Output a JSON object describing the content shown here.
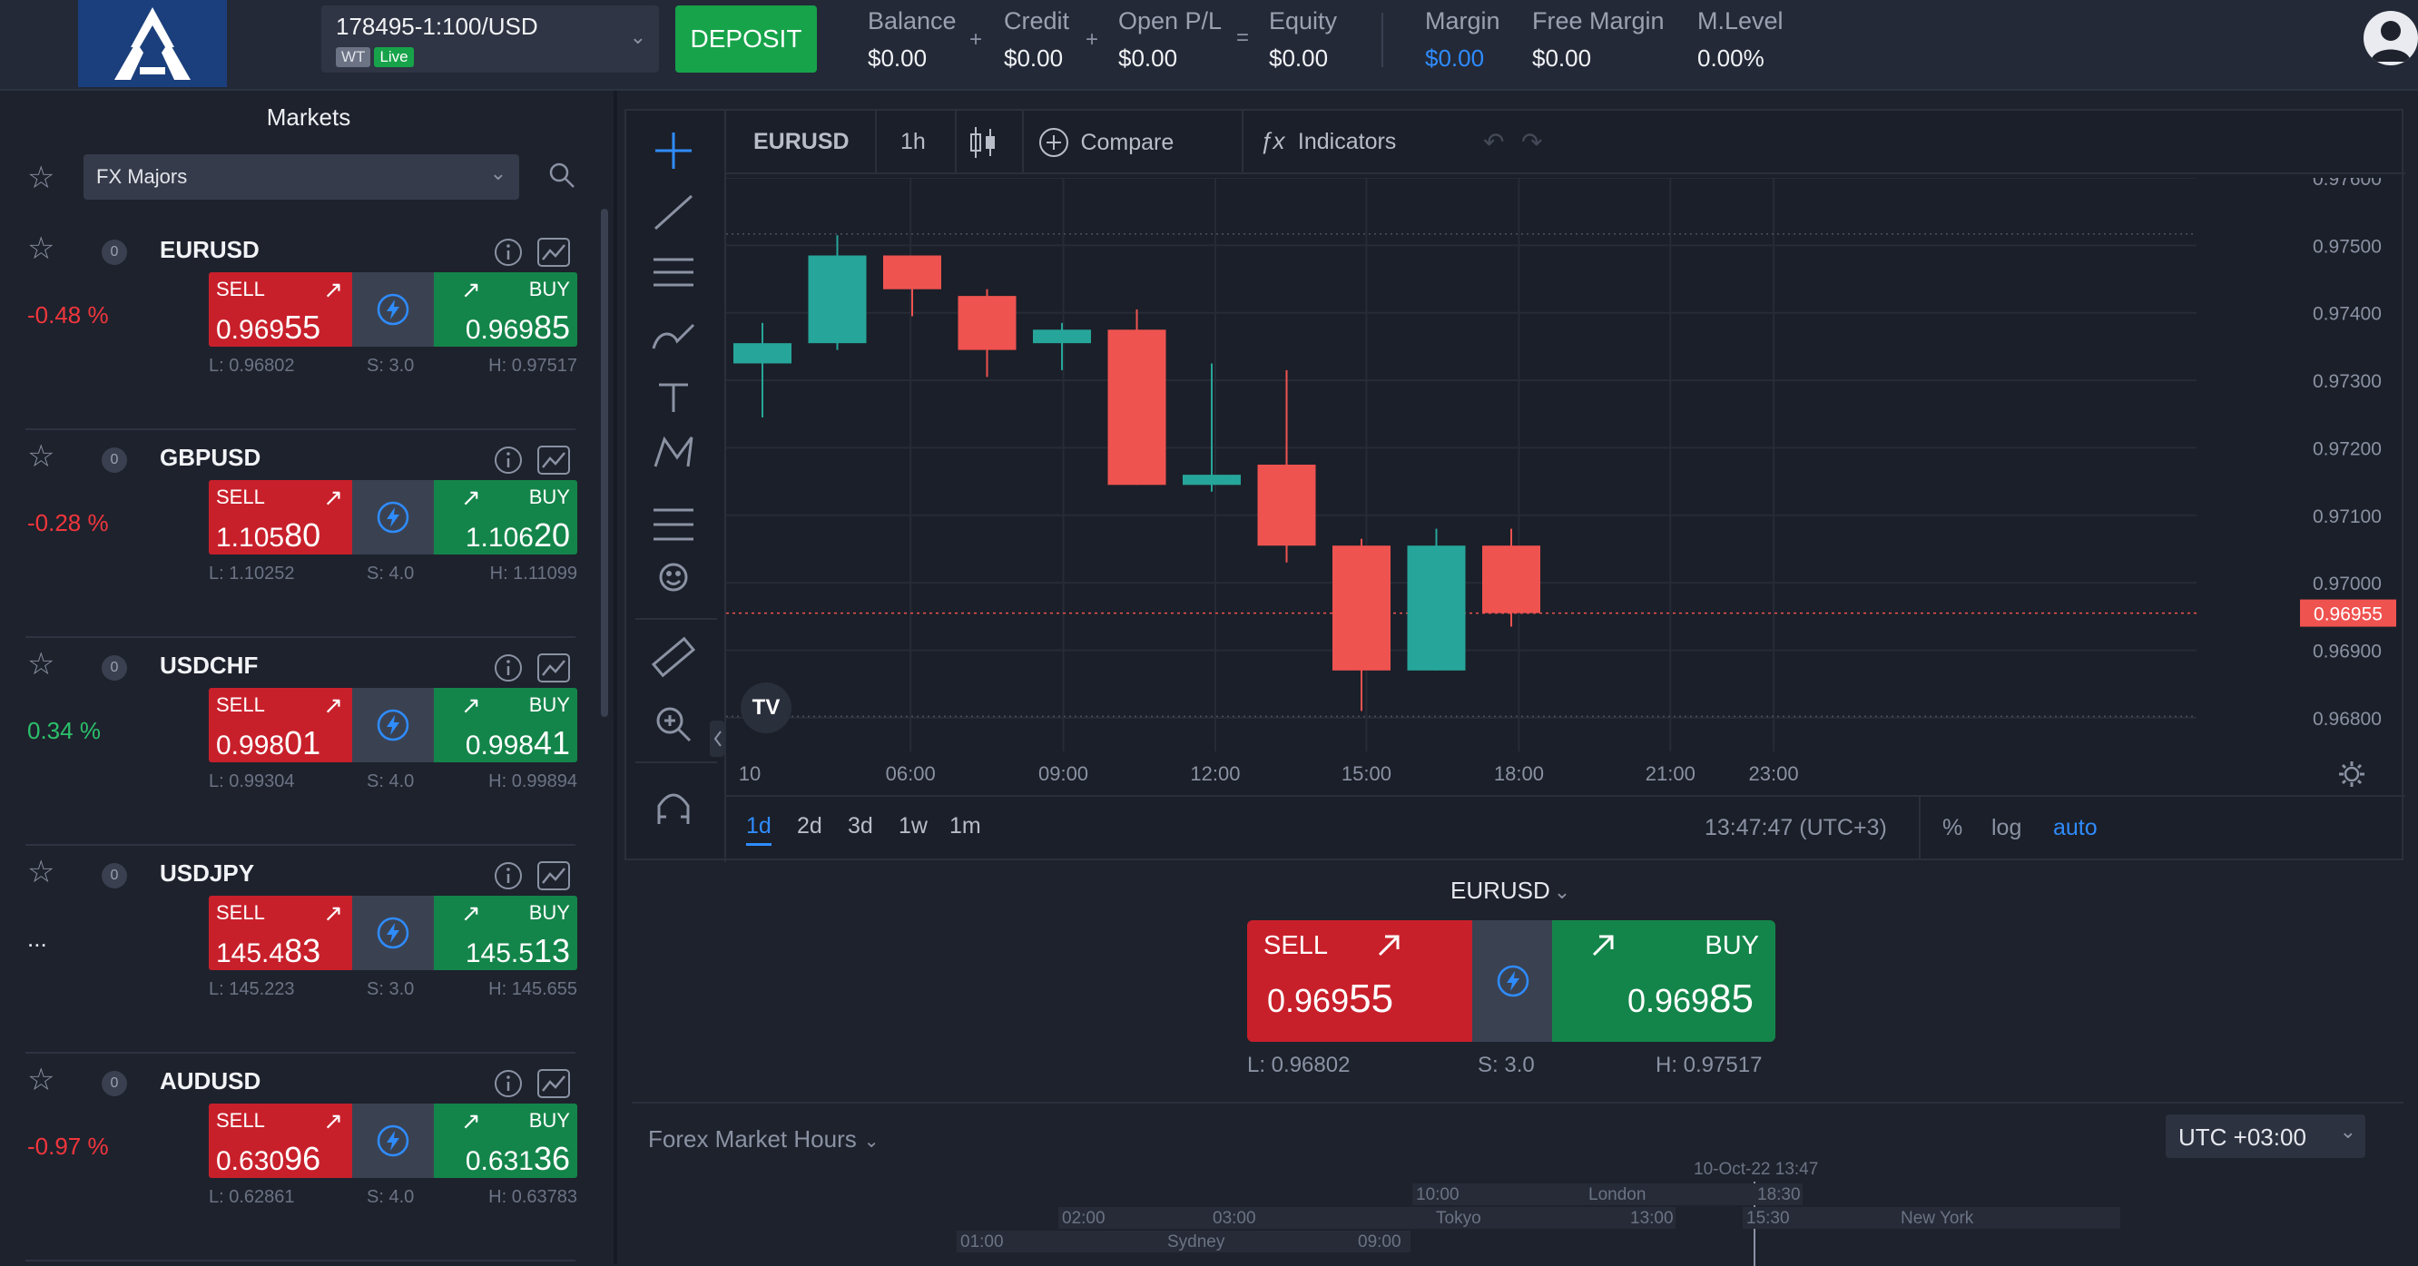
{
  "header": {
    "account_id": "178495-1:100/USD",
    "tag_wt": "WT",
    "tag_live": "Live",
    "deposit_label": "DEPOSIT",
    "stats": [
      {
        "label": "Balance",
        "value": "$0.00"
      },
      {
        "label": "Credit",
        "value": "$0.00"
      },
      {
        "label": "Open P/L",
        "value": "$0.00"
      },
      {
        "label": "Equity",
        "value": "$0.00"
      },
      {
        "label": "Margin",
        "value": "$0.00"
      },
      {
        "label": "Free Margin",
        "value": "$0.00"
      },
      {
        "label": "M.Level",
        "value": "0.00%"
      }
    ],
    "op_plus": "+",
    "op_eq": "="
  },
  "sidebar": {
    "title": "Markets",
    "filter": "FX Majors",
    "sell_label": "SELL",
    "buy_label": "BUY",
    "items": [
      {
        "symbol": "EURUSD",
        "count": "0",
        "change": "-0.48 %",
        "dir": "down",
        "sell": "0.96955",
        "buy": "0.96985",
        "low": "L: 0.96802",
        "spread": "S: 3.0",
        "high": "H: 0.97517"
      },
      {
        "symbol": "GBPUSD",
        "count": "0",
        "change": "-0.28 %",
        "dir": "down",
        "sell": "1.10580",
        "buy": "1.10620",
        "low": "L: 1.10252",
        "spread": "S: 4.0",
        "high": "H: 1.11099"
      },
      {
        "symbol": "USDCHF",
        "count": "0",
        "change": "0.34 %",
        "dir": "up",
        "sell": "0.99801",
        "buy": "0.99841",
        "low": "L: 0.99304",
        "spread": "S: 4.0",
        "high": "H: 0.99894"
      },
      {
        "symbol": "USDJPY",
        "count": "0",
        "change": "...",
        "dir": "none",
        "sell": "145.483",
        "buy": "145.513",
        "low": "L: 145.223",
        "spread": "S: 3.0",
        "high": "H: 145.655"
      },
      {
        "symbol": "AUDUSD",
        "count": "0",
        "change": "-0.97 %",
        "dir": "down",
        "sell": "0.63096",
        "buy": "0.63136",
        "low": "L: 0.62861",
        "spread": "S: 4.0",
        "high": "H: 0.63783"
      }
    ]
  },
  "chart": {
    "symbol": "EURUSD",
    "interval": "1h",
    "compare_label": "Compare",
    "indicators_label": "Indicators",
    "time_label_first": "10",
    "range_buttons": [
      "1d",
      "2d",
      "3d",
      "1w",
      "1m"
    ],
    "active_range": "1d",
    "clock": "13:47:47 (UTC+3)",
    "opt_pct": "%",
    "opt_log": "log",
    "opt_auto": "auto",
    "current_price": "0.96955",
    "logo_text": "TV"
  },
  "chart_data": {
    "type": "candlestick",
    "x_ticks": [
      "10",
      "06:00",
      "09:00",
      "12:00",
      "15:00",
      "18:00",
      "21:00",
      "23:00"
    ],
    "y_ticks": [
      "0.97600",
      "0.97500",
      "0.97400",
      "0.97300",
      "0.97200",
      "0.97100",
      "0.97000",
      "0.96900",
      "0.96800"
    ],
    "ylim": [
      0.9675,
      0.976
    ],
    "current_price": 0.96955,
    "candles": [
      {
        "o": 0.97325,
        "h": 0.97385,
        "l": 0.97245,
        "c": 0.97355
      },
      {
        "o": 0.97355,
        "h": 0.97515,
        "l": 0.97345,
        "c": 0.97485
      },
      {
        "o": 0.97485,
        "h": 0.97485,
        "l": 0.97395,
        "c": 0.97435
      },
      {
        "o": 0.97425,
        "h": 0.97435,
        "l": 0.97305,
        "c": 0.97345
      },
      {
        "o": 0.97355,
        "h": 0.97385,
        "l": 0.97315,
        "c": 0.97375
      },
      {
        "o": 0.97375,
        "h": 0.97405,
        "l": 0.97145,
        "c": 0.97145
      },
      {
        "o": 0.97145,
        "h": 0.97325,
        "l": 0.97135,
        "c": 0.9716
      },
      {
        "o": 0.97175,
        "h": 0.97315,
        "l": 0.9703,
        "c": 0.97055
      },
      {
        "o": 0.97055,
        "h": 0.97065,
        "l": 0.9681,
        "c": 0.9687
      },
      {
        "o": 0.9687,
        "h": 0.9708,
        "l": 0.9687,
        "c": 0.97055
      },
      {
        "o": 0.97055,
        "h": 0.9708,
        "l": 0.96935,
        "c": 0.96955
      }
    ]
  },
  "trade": {
    "symbol": "EURUSD",
    "sell_label": "SELL",
    "buy_label": "BUY",
    "sell": "0.96955",
    "buy": "0.96985",
    "low": "L: 0.96802",
    "spread": "S: 3.0",
    "high": "H: 0.97517"
  },
  "forex": {
    "title": "Forex Market Hours",
    "tz": "UTC +03:00",
    "now": "10-Oct-22 13:47",
    "sessions": [
      {
        "name": "Sydney",
        "open": "01:00",
        "close": "09:00"
      },
      {
        "name": "Tokyo",
        "open": "03:00",
        "close": "13:00"
      },
      {
        "name": "London",
        "open": "10:00",
        "close": "18:30"
      },
      {
        "name": "New York",
        "open": "15:30",
        "close": ""
      }
    ],
    "extra_time": "02:00"
  },
  "colors": {
    "up": "#26a69a",
    "down": "#ef5350",
    "sell": "#c8202b",
    "buy": "#14854a",
    "accent": "#2962ff"
  }
}
